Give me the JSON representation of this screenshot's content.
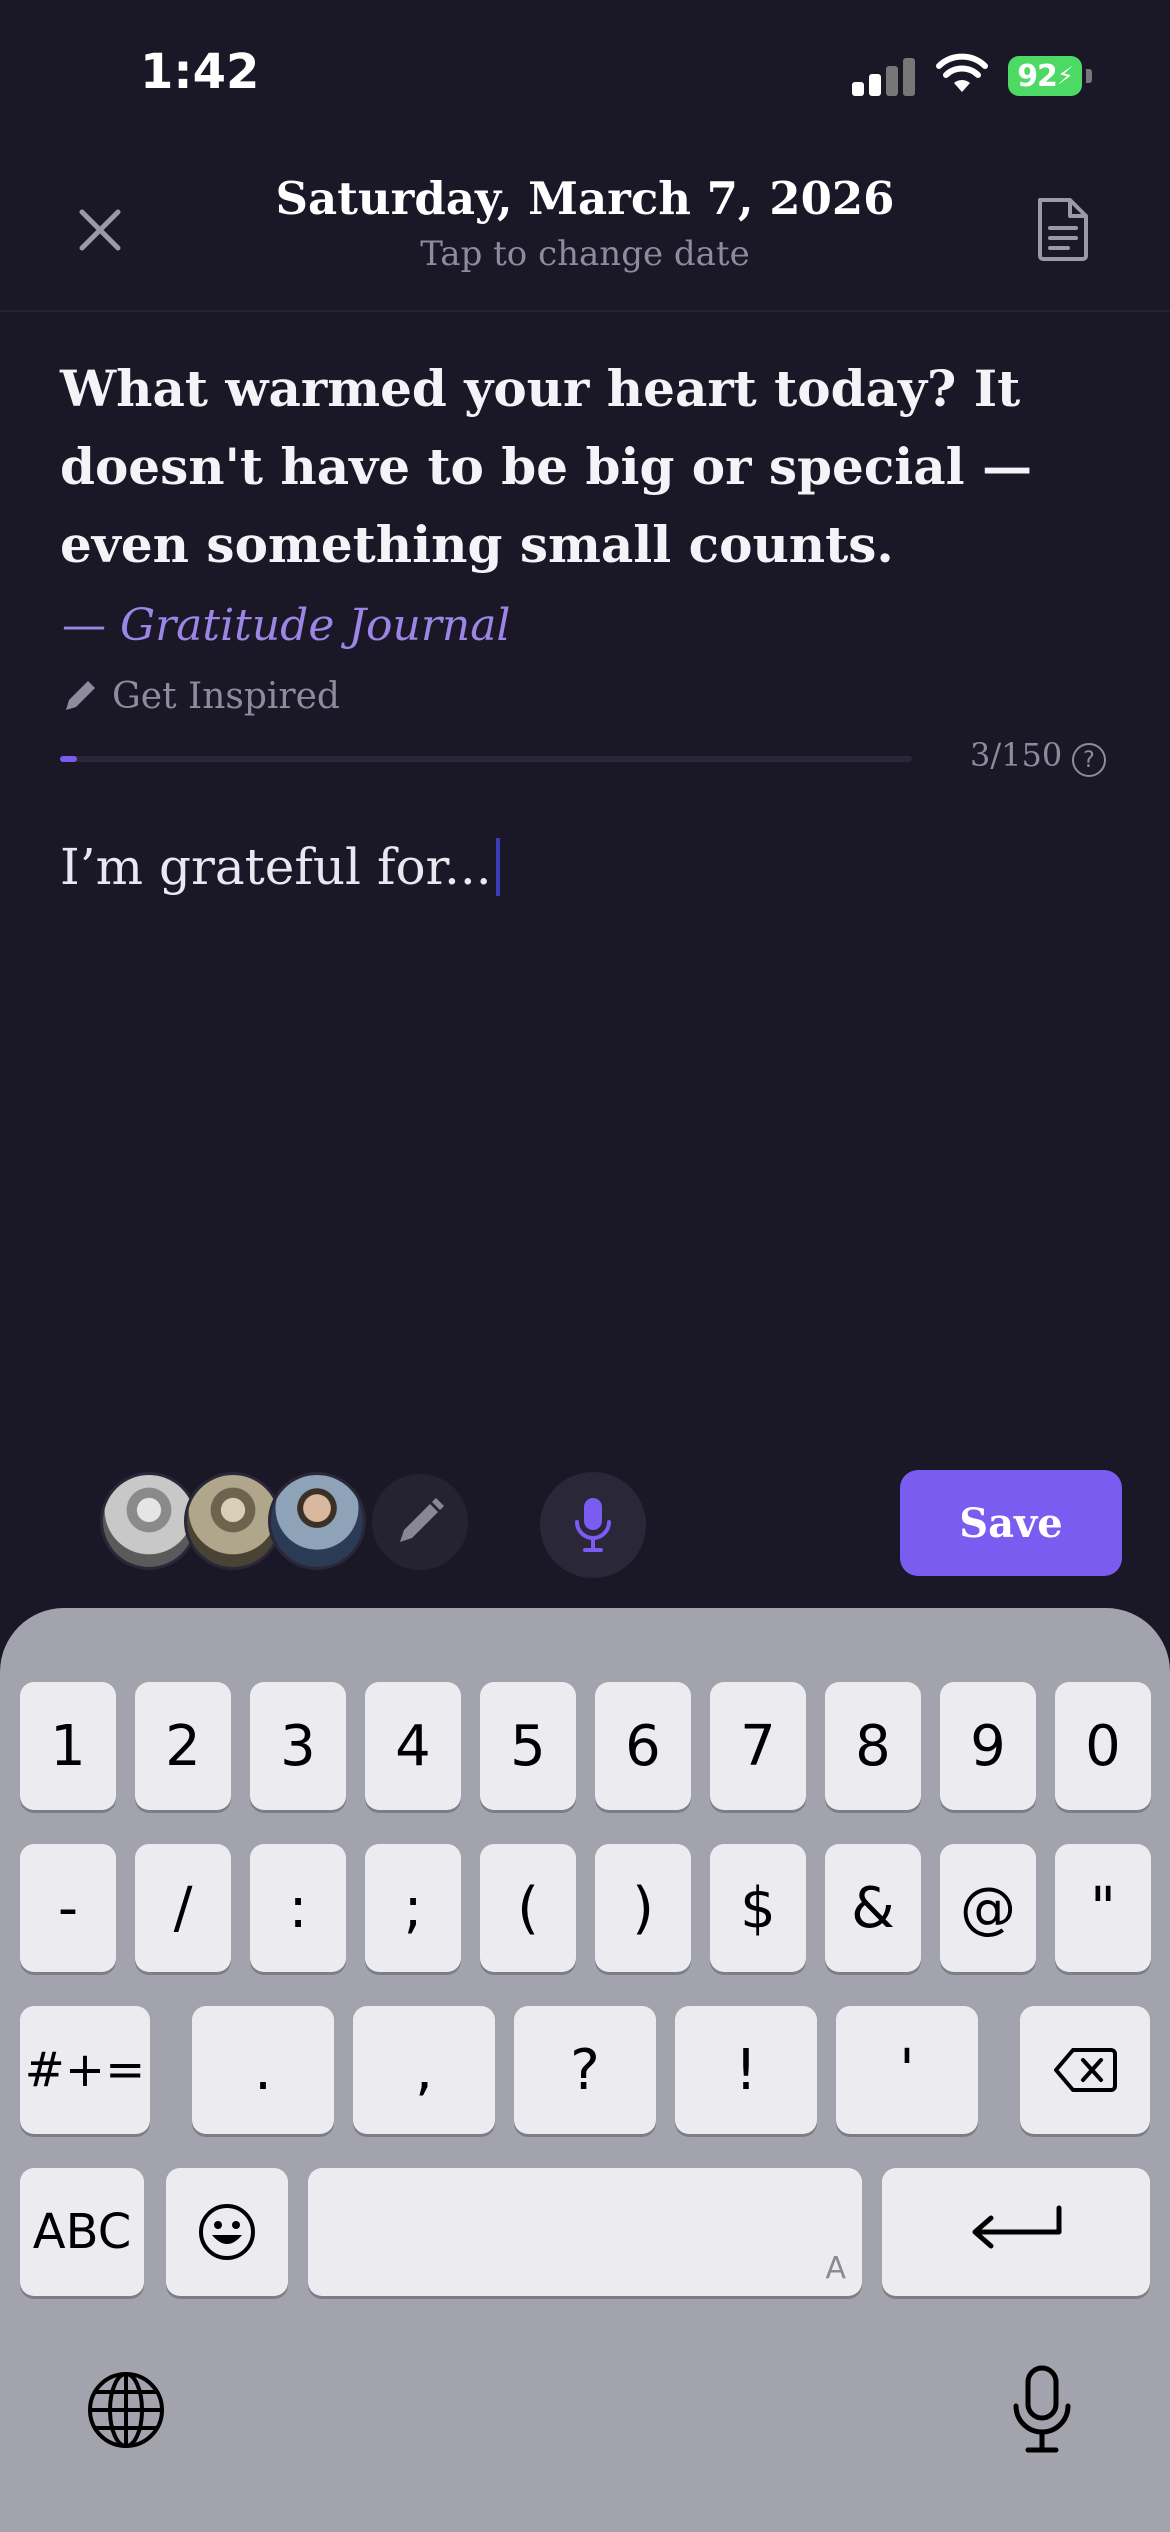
{
  "status_bar": {
    "time": "1:42",
    "battery": "92"
  },
  "header": {
    "title": "Saturday, March 7, 2026",
    "subtitle": "Tap to change date"
  },
  "prompt": {
    "text": "What warmed your heart today? It doesn't have to be big or special — even something small counts.",
    "attribution": "— Gratitude Journal",
    "inspire_label": "Get Inspired"
  },
  "progress": {
    "count_label": "3/150",
    "fraction": 0.02
  },
  "entry": {
    "text": "I’m grateful for..."
  },
  "toolbar": {
    "save_label": "Save"
  },
  "keyboard": {
    "row1": [
      "1",
      "2",
      "3",
      "4",
      "5",
      "6",
      "7",
      "8",
      "9",
      "0"
    ],
    "row2": [
      "-",
      "/",
      ":",
      ";",
      "(",
      ")",
      "$",
      "&",
      "@",
      "\""
    ],
    "row3": [
      "#+=",
      ".",
      ",",
      "?",
      "!",
      "'"
    ],
    "abc_label": "ABC",
    "space_mark": "A"
  },
  "colors": {
    "accent": "#7b5cf0",
    "background": "#1a1726",
    "attribution": "#9b86e6"
  }
}
